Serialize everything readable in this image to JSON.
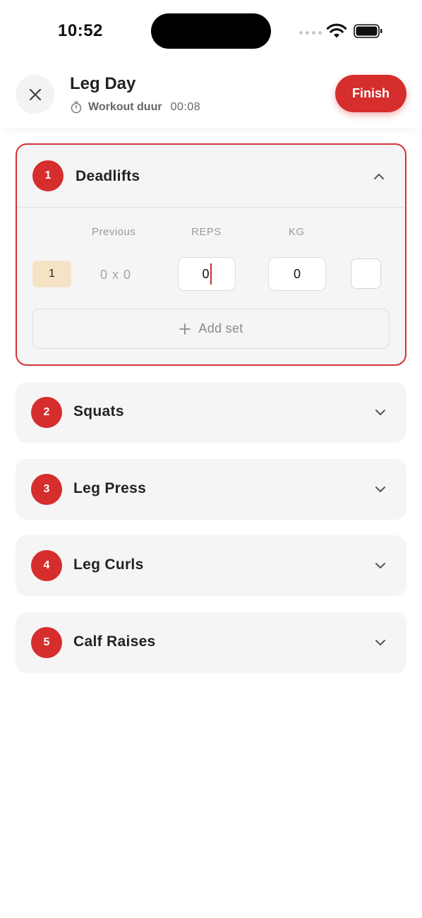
{
  "status_bar": {
    "time": "10:52"
  },
  "header": {
    "title": "Leg Day",
    "duration_label": "Workout duur",
    "duration_value": "00:08",
    "finish_label": "Finish"
  },
  "exercise_table": {
    "col_previous": "Previous",
    "col_reps": "REPS",
    "col_kg": "KG",
    "add_set_label": "Add set",
    "sets": [
      {
        "number": "1",
        "previous": "0 x 0",
        "reps": "0",
        "kg": "0",
        "done": false
      }
    ]
  },
  "exercises": [
    {
      "number": "1",
      "name": "Deadlifts",
      "expanded": true
    },
    {
      "number": "2",
      "name": "Squats",
      "expanded": false
    },
    {
      "number": "3",
      "name": "Leg Press",
      "expanded": false
    },
    {
      "number": "4",
      "name": "Leg Curls",
      "expanded": false
    },
    {
      "number": "5",
      "name": "Calf Raises",
      "expanded": false
    }
  ],
  "colors": {
    "accent": "#d62d2d",
    "set_badge": "#f6e3c6",
    "card_bg": "#f5f5f5"
  },
  "icons": {
    "close": "close-icon",
    "timer": "timer-icon",
    "expand": "chevron-down-icon",
    "collapse": "chevron-up-icon",
    "add": "plus-icon"
  }
}
